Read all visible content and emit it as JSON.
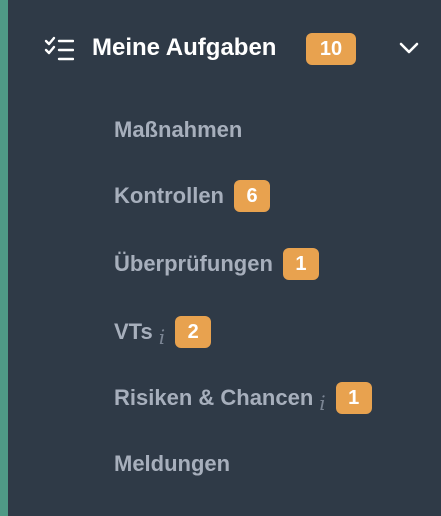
{
  "section": {
    "title": "Meine Aufgaben",
    "count": "10",
    "icon": "task-list-icon",
    "toggle_icon": "chevron-down-icon"
  },
  "items": [
    {
      "label": "Maßnahmen",
      "count": null,
      "info": false
    },
    {
      "label": "Kontrollen",
      "count": "6",
      "info": false
    },
    {
      "label": "Überprüfungen",
      "count": "1",
      "info": false
    },
    {
      "label": "VTs",
      "count": "2",
      "info": true,
      "info_glyph": "i"
    },
    {
      "label": "Risiken & Chancen",
      "count": "1",
      "info": true,
      "info_glyph": "i"
    },
    {
      "label": "Meldungen",
      "count": null,
      "info": false
    }
  ],
  "colors": {
    "background": "#2f3a47",
    "accent_bar": "#4f9a86",
    "badge": "#e8a24f",
    "header_text": "#ffffff",
    "item_text": "#a7afbc"
  }
}
